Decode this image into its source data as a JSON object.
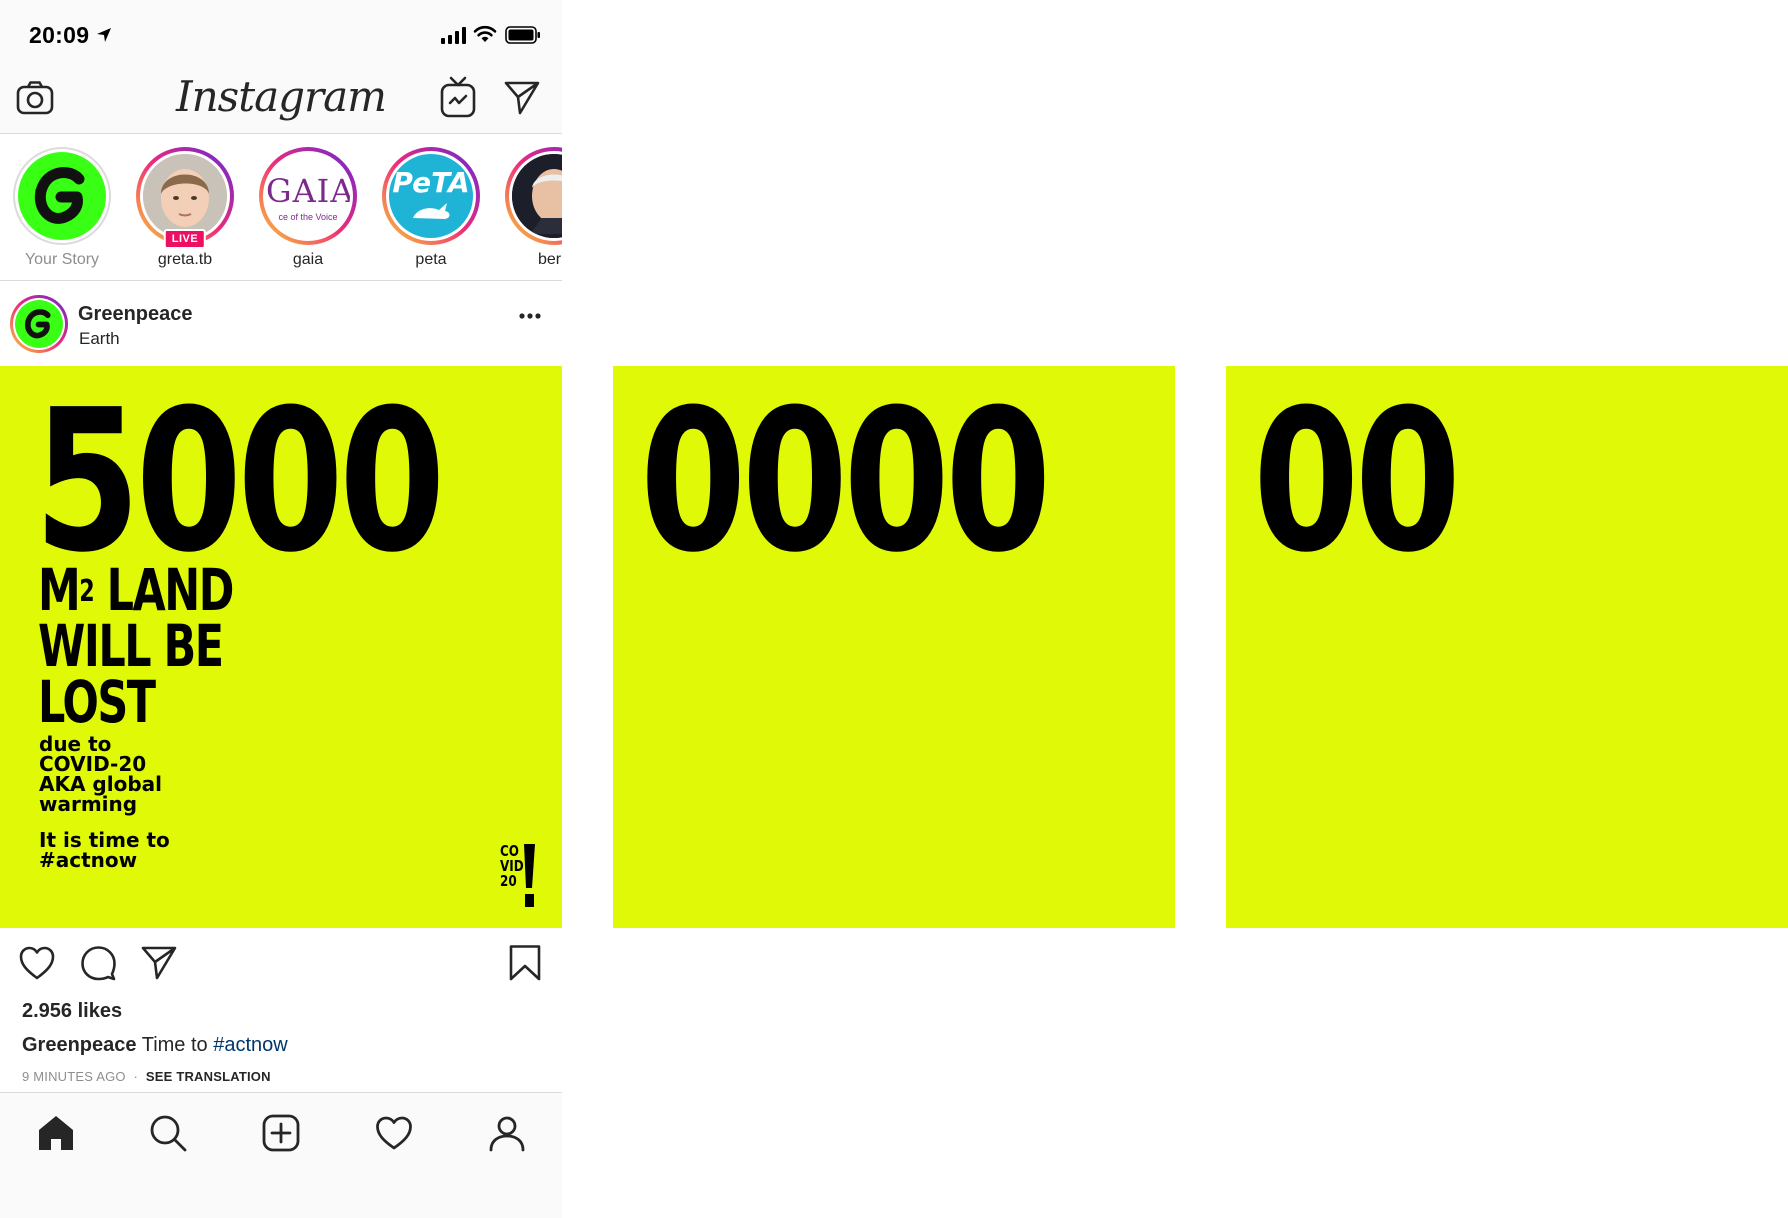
{
  "status_bar": {
    "time": "20:09"
  },
  "app": {
    "logo_text": "Instagram"
  },
  "stories": [
    {
      "name": "Your Story",
      "own": true
    },
    {
      "name": "greta.tb",
      "live": "LIVE"
    },
    {
      "name": "gaia",
      "logo_text": "GAIA",
      "logo_sub": "ce of the Voice"
    },
    {
      "name": "peta",
      "logo_text": "PeTA"
    },
    {
      "name": "bern"
    }
  ],
  "post": {
    "username": "Greenpeace",
    "location": "Earth",
    "likes": "2.956 likes",
    "caption_user": "Greenpeace",
    "caption_text": "Time to",
    "caption_tag": "#actnow",
    "time_ago": "9 MINUTES AGO",
    "separator": "·",
    "see_translation": "SEE TRANSLATION"
  },
  "panels": [
    {
      "digits": "5000",
      "headline": [
        "M",
        "LAND",
        "WILL BE",
        "LOST"
      ],
      "headline_sup": "2",
      "sub": [
        "due to",
        "COVID-20",
        "AKA global",
        "warming"
      ],
      "cta": [
        "It is time to",
        "#actnow"
      ],
      "logo_mark": [
        "CO",
        "VID",
        "20"
      ]
    },
    {
      "digits": "0000"
    },
    {
      "digits": "00"
    }
  ],
  "colors": {
    "panel_bg": "#dff906",
    "greenpeace_green": "#39ff14",
    "live_badge": "#ed0f62",
    "hashtag": "#00376b",
    "peta_blue": "#1fb3d6",
    "gaia_purple": "#7b2a8c"
  },
  "icons": {
    "camera": "camera-icon",
    "igtv": "igtv-icon",
    "direct": "direct-icon",
    "like": "heart-icon",
    "comment": "comment-icon",
    "share": "share-icon",
    "save": "bookmark-icon",
    "home": "home-icon",
    "search": "search-icon",
    "new_post": "plus-square-icon",
    "activity": "heart-icon",
    "profile": "profile-icon"
  }
}
